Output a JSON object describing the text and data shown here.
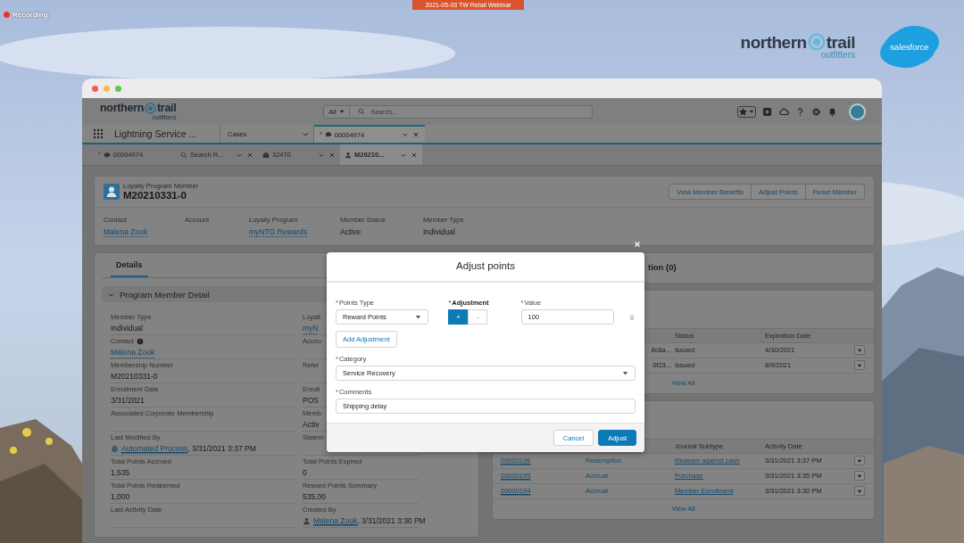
{
  "recording": {
    "label": "Recording"
  },
  "banner": {
    "label": "2021-05-03 TW Retail Webinar"
  },
  "event_logo": {
    "word_1": "northern",
    "word_2": "trail",
    "tagline": "outfitters"
  },
  "partner_logo": {
    "label": "salesforce"
  },
  "header": {
    "logo": {
      "word_1": "northern",
      "word_2": "trail",
      "tagline": "outfitters"
    },
    "search_scope": "All",
    "search_placeholder": "Search..."
  },
  "nav": {
    "app_name": "Lightning Service ...",
    "object_tab": "Cases",
    "tabs": [
      {
        "label": "00004974",
        "marker": "*",
        "kind": "chat",
        "selected": true
      }
    ]
  },
  "subtabs": [
    {
      "label": "00004974",
      "marker": "*",
      "kind": "chat",
      "selected": false,
      "closable": false
    },
    {
      "label": "Search R...",
      "kind": "search",
      "selected": false,
      "closable": true
    },
    {
      "label": "32470",
      "kind": "case",
      "selected": false,
      "closable": true
    },
    {
      "label": "M20210...",
      "kind": "person",
      "selected": true,
      "closable": true
    }
  ],
  "record": {
    "object": "Loyalty Program Member",
    "name": "M20210331-0",
    "actions": [
      "View Member Benefits",
      "Adjust Points",
      "Reset Member"
    ],
    "highlights": [
      {
        "label": "Contact",
        "value": "Malena Zook",
        "link": true
      },
      {
        "label": "Account"
      },
      {
        "label": "Loyalty Program",
        "value": "myNTO Rewards",
        "link": true
      },
      {
        "label": "Member Status",
        "value": "Active",
        "link": false
      },
      {
        "label": "Member Type",
        "value": "Individual",
        "link": false
      }
    ]
  },
  "details": {
    "tabs": [
      {
        "label": "Details",
        "selected": true
      }
    ],
    "section": {
      "title": "Program Member Detail",
      "expanded": true
    },
    "columns": [
      [
        {
          "label": "Member Type",
          "value": "Individual",
          "link": false
        },
        {
          "label": "Contact",
          "info": true,
          "value": "Malena Zook",
          "link": true
        },
        {
          "label": "Membership Number",
          "value": "M20210331-0",
          "link": false
        },
        {
          "label": "Enrollment Date",
          "value": "3/31/2021",
          "link": false
        },
        {
          "label": "Associated Corporate Membership"
        },
        {
          "label": "Last Modified By",
          "kind": "process_avatar",
          "value": "Automated Process",
          "link": true,
          "suffix": ", 3/31/2021 3:37 PM"
        },
        {
          "label": "Total Points Accrued",
          "value": "1,535",
          "link": false
        },
        {
          "label": "Total Points Redeemed",
          "value": "1,000",
          "link": false
        },
        {
          "label": "Last Activity Date"
        }
      ],
      [
        {
          "label": "Loyalt",
          "value": "myN",
          "link": true
        },
        {
          "label": "Accou"
        },
        {
          "label": "Refer"
        },
        {
          "label": "Enroll",
          "value": "POS",
          "link": false
        },
        {
          "label": "Memb",
          "value": "Activ",
          "link": false
        },
        {
          "label": "Statem"
        },
        {
          "label": "Total Points Expired",
          "value": "0",
          "link": false
        },
        {
          "label": "Reward Points Summary",
          "value": "535.00",
          "link": false
        },
        {
          "label": "Created By",
          "kind": "person_avatar",
          "value": "Malena Zook",
          "link": true,
          "suffix": ", 3/31/2021 3:30 PM"
        }
      ]
    ]
  },
  "related_title": "tion (0)",
  "benefits_table": {
    "columns": [
      "Status",
      "Expiration Date"
    ],
    "rows": [
      {
        "reference": "8c6a...",
        "status": "Issued",
        "expiration": "4/30/2021"
      },
      {
        "reference": "0f23...",
        "status": "Issued",
        "expiration": "8/9/2021"
      }
    ],
    "footer": "View All"
  },
  "journals_table": {
    "columns": [
      "Journal Subtype",
      "Activity Date"
    ],
    "rows": [
      {
        "number": "00000196",
        "type": "Redemption",
        "subtype": "Redeem against cash",
        "date": "3/31/2021 3:37 PM"
      },
      {
        "number": "00000195",
        "type": "Accrual",
        "subtype": "Purchase",
        "date": "3/31/2021 3:35 PM"
      },
      {
        "number": "00000194",
        "type": "Accrual",
        "subtype": "Member Enrollment",
        "date": "3/31/2021 3:30 PM"
      }
    ],
    "footer": "View All"
  },
  "modal": {
    "title": "Adjust points",
    "points_type": {
      "required_mark": "*",
      "label": "Points Type",
      "value": "Reward Points"
    },
    "adjustment": {
      "required_mark": "*",
      "label": "Adjustment",
      "options": [
        {
          "label": "+",
          "selected": true
        },
        {
          "label": "-",
          "selected": false
        }
      ]
    },
    "value": {
      "required_mark": "*",
      "label": "Value",
      "value": "100"
    },
    "add_button": "Add Adjustment",
    "category": {
      "required_mark": "*",
      "label": "Category",
      "value": "Service Recovery"
    },
    "comments": {
      "required_mark": "*",
      "label": "Comments",
      "value": "Shipping delay"
    },
    "buttons": [
      {
        "label": "Cancel",
        "kind": "neutral"
      },
      {
        "label": "Adjust",
        "kind": "brand"
      }
    ]
  }
}
